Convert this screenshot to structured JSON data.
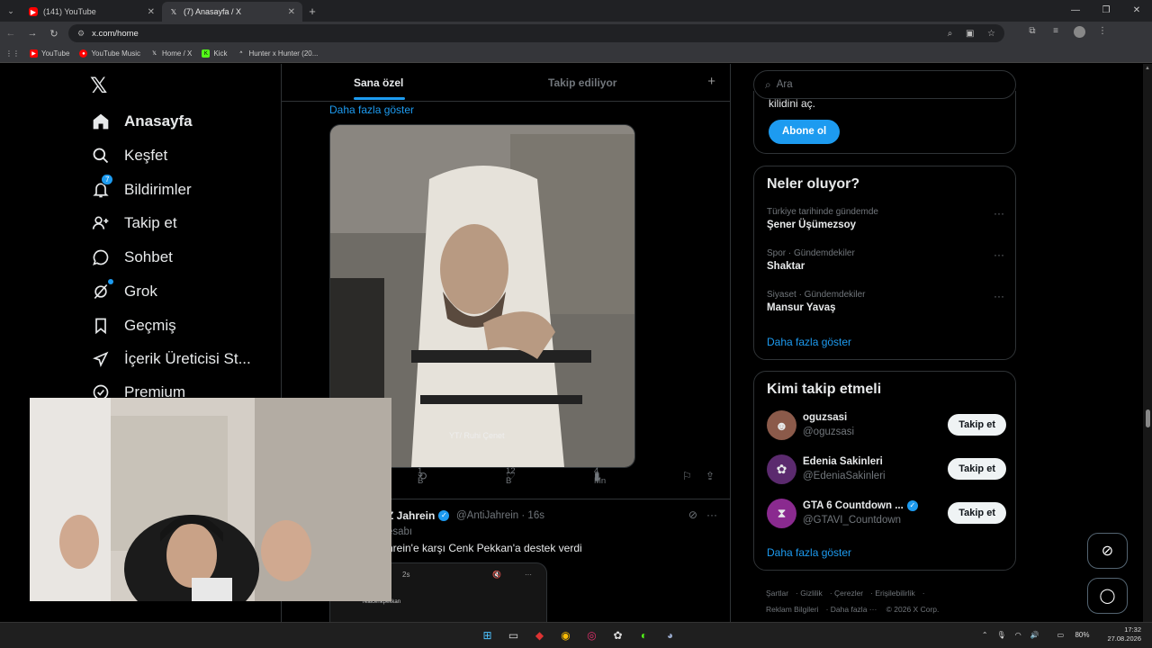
{
  "browser": {
    "tabs": [
      {
        "title": "(141) YouTube",
        "icon": "youtube-icon"
      },
      {
        "title": "(7) Anasayfa / X",
        "icon": "x-logo-icon"
      }
    ],
    "url": "x.com/home",
    "bookmarks": [
      "YouTube",
      "YouTube Music",
      "Home / X",
      "Kick",
      "Hunter x Hunter (20..."
    ]
  },
  "nav": {
    "items": [
      {
        "label": "Anasayfa",
        "icon": "home-icon"
      },
      {
        "label": "Keşfet",
        "icon": "search-icon"
      },
      {
        "label": "Bildirimler",
        "icon": "bell-icon",
        "badge": "7"
      },
      {
        "label": "Takip et",
        "icon": "add-user-icon"
      },
      {
        "label": "Sohbet",
        "icon": "chat-icon"
      },
      {
        "label": "Grok",
        "icon": "grok-icon"
      },
      {
        "label": "Geçmiş",
        "icon": "bookmark-icon"
      },
      {
        "label": "İçerik Üreticisi St...",
        "icon": "rocket-icon"
      },
      {
        "label": "Premium",
        "icon": "verified-icon"
      }
    ]
  },
  "main": {
    "tabs": [
      "Sana özel",
      "Takip ediliyor"
    ],
    "show_more": "Daha fazla göster",
    "media_watermark": "YT/ Ruhi Çenet",
    "stats": {
      "reposts": "1 B",
      "likes": "12 B",
      "views": "4 Mn"
    },
    "tweet2": {
      "name": "Z Jahrein",
      "handle": "@AntiJahrein · 16s",
      "subline": "esabı",
      "text": "hrein'e karşı Cenk Pekkan'a destek verdi",
      "media_time": "2s",
      "media_user": "realcenkpekkan"
    }
  },
  "right": {
    "search_placeholder": "Ara",
    "premium_snippet": "kilidini aç.",
    "subscribe": "Abone ol",
    "trends_title": "Neler oluyor?",
    "trends": [
      {
        "meta": "Türkiye tarihinde gündemde",
        "topic": "Şener Üşümezsoy"
      },
      {
        "meta": "Spor · Gündemdekiler",
        "topic": "Shaktar"
      },
      {
        "meta": "Siyaset · Gündemdekiler",
        "topic": "Mansur Yavaş"
      }
    ],
    "trends_more": "Daha fazla göster",
    "who_title": "Kimi takip etmeli",
    "who": [
      {
        "name": "oguzsasi",
        "handle": "@oguzsasi",
        "verified": false
      },
      {
        "name": "Edenia Sakinleri",
        "handle": "@EdeniaSakinleri",
        "verified": false
      },
      {
        "name": "GTA 6 Countdown ...",
        "handle": "@GTAVI_Countdown",
        "verified": true
      }
    ],
    "follow_label": "Takip et",
    "who_more": "Daha fazla göster",
    "footer": [
      "Şartlar",
      "Gizlilik",
      "Çerezler",
      "Erişilebilirlik",
      "Reklam Bilgileri",
      "Daha fazla ···",
      "© 2026 X Corp."
    ]
  },
  "taskbar": {
    "battery": "80%",
    "time": "17:32",
    "date": "27.08.2026"
  },
  "colors": {
    "accent": "#1d9bf0",
    "background": "#000000",
    "border": "#2f3336",
    "muted": "#71767b"
  }
}
